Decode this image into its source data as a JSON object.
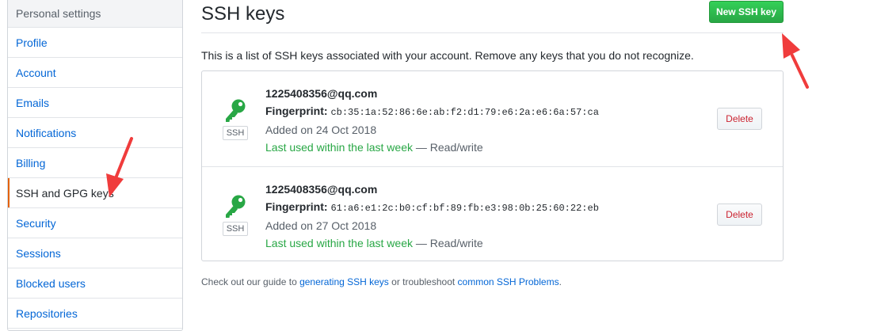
{
  "sidebar": {
    "heading": "Personal settings",
    "items": [
      {
        "label": "Profile",
        "selected": false
      },
      {
        "label": "Account",
        "selected": false
      },
      {
        "label": "Emails",
        "selected": false
      },
      {
        "label": "Notifications",
        "selected": false
      },
      {
        "label": "Billing",
        "selected": false
      },
      {
        "label": "SSH and GPG keys",
        "selected": true
      },
      {
        "label": "Security",
        "selected": false
      },
      {
        "label": "Sessions",
        "selected": false
      },
      {
        "label": "Blocked users",
        "selected": false
      },
      {
        "label": "Repositories",
        "selected": false
      }
    ]
  },
  "main": {
    "title": "SSH keys",
    "new_button": "New SSH key",
    "intro": "This is a list of SSH keys associated with your account. Remove any keys that you do not recognize.",
    "keys": [
      {
        "title": "1225408356@qq.com",
        "fingerprint_label": "Fingerprint:",
        "fingerprint": "cb:35:1a:52:86:6e:ab:f2:d1:79:e6:2a:e6:6a:57:ca",
        "added": "Added on 24 Oct 2018",
        "last_used": "Last used within the last week",
        "access": "— Read/write",
        "badge": "SSH",
        "delete_label": "Delete"
      },
      {
        "title": "1225408356@qq.com",
        "fingerprint_label": "Fingerprint:",
        "fingerprint": "61:a6:e1:2c:b0:cf:bf:89:fb:e3:98:0b:25:60:22:eb",
        "added": "Added on 27 Oct 2018",
        "last_used": "Last used within the last week",
        "access": "— Read/write",
        "badge": "SSH",
        "delete_label": "Delete"
      }
    ],
    "footer": {
      "prefix": "Check out our guide to ",
      "link1": "generating SSH keys",
      "middle": " or troubleshoot ",
      "link2": "common SSH Problems",
      "suffix": "."
    }
  },
  "colors": {
    "key_icon": "#28a745",
    "annotation_arrow": "#f03c3c",
    "selected_accent": "#e36209"
  }
}
